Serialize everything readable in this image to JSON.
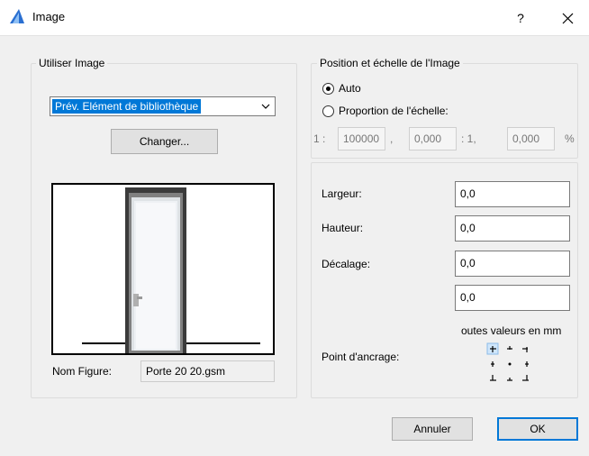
{
  "window": {
    "title": "Image",
    "help_label": "?"
  },
  "use_image": {
    "legend": "Utiliser Image",
    "dropdown_value": "Prév. Elément de bibliothèque",
    "change_button": "Changer...",
    "name_label": "Nom Figure:",
    "name_value": "Porte 20 20.gsm"
  },
  "position": {
    "legend": "Position et échelle de l'Image",
    "radio_auto": "Auto",
    "radio_scale": "Proportion de l'échelle:",
    "selected_mode": "Auto",
    "scale_prefix": "1 :",
    "scale_value": "100000",
    "comma": ",",
    "scale_second": "0,000",
    "scale_mid": ": 1,",
    "scale_third": "0,000",
    "percent": "%"
  },
  "dimensions": {
    "width_label": "Largeur:",
    "width_value": "0,0",
    "height_label": "Hauteur:",
    "height_value": "0,0",
    "offset_label": "Décalage:",
    "offset_x_value": "0,0",
    "offset_y_value": "0,0",
    "units_note": "outes valeurs en mm",
    "anchor_label": "Point d'ancrage:",
    "anchor_selected": "top-left"
  },
  "footer": {
    "cancel_label": "Annuler",
    "ok_label": "OK"
  },
  "colors": {
    "selection_blue": "#0078d7",
    "app_icon_blue": "#2a6fd1"
  }
}
